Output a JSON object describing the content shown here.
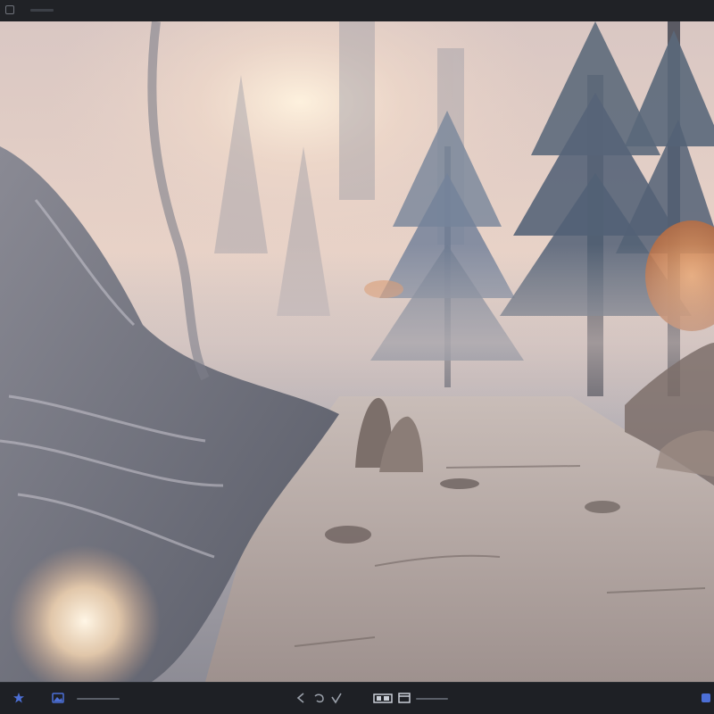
{
  "scene": {
    "subject": "misty-forest-path",
    "colors": {
      "sky": "#e9d4c8",
      "sun_glow": "#fff3df",
      "mist": "#cdbbb8",
      "trees": "#5e6c7d",
      "autumn_leaves": "#d9905f",
      "path": "#b9aba4",
      "rocks": "#7c6f6a",
      "frame": "#1d1f24"
    }
  },
  "toolbar": {
    "top_icon": "window-icon",
    "bottom_icons": [
      "star-icon",
      "image-icon",
      "back-icon",
      "undo-icon",
      "check-icon",
      "gallery-icon",
      "window-icon",
      "settings-icon"
    ]
  }
}
